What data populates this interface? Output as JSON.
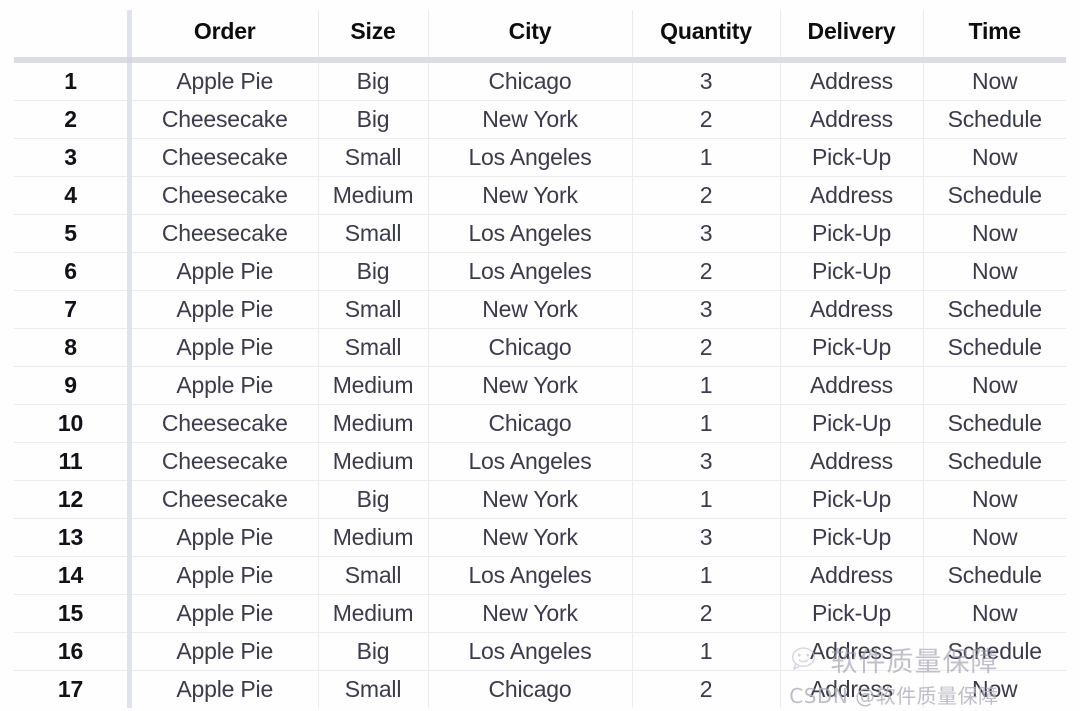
{
  "table": {
    "index_header": "",
    "columns": [
      "Order",
      "Size",
      "City",
      "Quantity",
      "Delivery",
      "Time"
    ],
    "rows": [
      {
        "index": "1",
        "Order": "Apple Pie",
        "Size": "Big",
        "City": "Chicago",
        "Quantity": "3",
        "Delivery": "Address",
        "Time": "Now"
      },
      {
        "index": "2",
        "Order": "Cheesecake",
        "Size": "Big",
        "City": "New York",
        "Quantity": "2",
        "Delivery": "Address",
        "Time": "Schedule"
      },
      {
        "index": "3",
        "Order": "Cheesecake",
        "Size": "Small",
        "City": "Los Angeles",
        "Quantity": "1",
        "Delivery": "Pick-Up",
        "Time": "Now"
      },
      {
        "index": "4",
        "Order": "Cheesecake",
        "Size": "Medium",
        "City": "New York",
        "Quantity": "2",
        "Delivery": "Address",
        "Time": "Schedule"
      },
      {
        "index": "5",
        "Order": "Cheesecake",
        "Size": "Small",
        "City": "Los Angeles",
        "Quantity": "3",
        "Delivery": "Pick-Up",
        "Time": "Now"
      },
      {
        "index": "6",
        "Order": "Apple Pie",
        "Size": "Big",
        "City": "Los Angeles",
        "Quantity": "2",
        "Delivery": "Pick-Up",
        "Time": "Now"
      },
      {
        "index": "7",
        "Order": "Apple Pie",
        "Size": "Small",
        "City": "New York",
        "Quantity": "3",
        "Delivery": "Address",
        "Time": "Schedule"
      },
      {
        "index": "8",
        "Order": "Apple Pie",
        "Size": "Small",
        "City": "Chicago",
        "Quantity": "2",
        "Delivery": "Pick-Up",
        "Time": "Schedule"
      },
      {
        "index": "9",
        "Order": "Apple Pie",
        "Size": "Medium",
        "City": "New York",
        "Quantity": "1",
        "Delivery": "Address",
        "Time": "Now"
      },
      {
        "index": "10",
        "Order": "Cheesecake",
        "Size": "Medium",
        "City": "Chicago",
        "Quantity": "1",
        "Delivery": "Pick-Up",
        "Time": "Schedule"
      },
      {
        "index": "11",
        "Order": "Cheesecake",
        "Size": "Medium",
        "City": "Los Angeles",
        "Quantity": "3",
        "Delivery": "Address",
        "Time": "Schedule"
      },
      {
        "index": "12",
        "Order": "Cheesecake",
        "Size": "Big",
        "City": "New York",
        "Quantity": "1",
        "Delivery": "Pick-Up",
        "Time": "Now"
      },
      {
        "index": "13",
        "Order": "Apple Pie",
        "Size": "Medium",
        "City": "New York",
        "Quantity": "3",
        "Delivery": "Pick-Up",
        "Time": "Now"
      },
      {
        "index": "14",
        "Order": "Apple Pie",
        "Size": "Small",
        "City": "Los Angeles",
        "Quantity": "1",
        "Delivery": "Address",
        "Time": "Schedule"
      },
      {
        "index": "15",
        "Order": "Apple Pie",
        "Size": "Medium",
        "City": "New York",
        "Quantity": "2",
        "Delivery": "Pick-Up",
        "Time": "Now"
      },
      {
        "index": "16",
        "Order": "Apple Pie",
        "Size": "Big",
        "City": "Los Angeles",
        "Quantity": "1",
        "Delivery": "Address",
        "Time": "Schedule"
      },
      {
        "index": "17",
        "Order": "Apple Pie",
        "Size": "Small",
        "City": "Chicago",
        "Quantity": "2",
        "Delivery": "Address",
        "Time": "Now"
      }
    ]
  },
  "watermark": {
    "icon": "wechat-icon",
    "title": "软件质量保障",
    "credit": "CSDN @软件质量保障"
  },
  "colors": {
    "header_text": "#0d0d0d",
    "body_text": "#3b3b4a",
    "index_text": "#111118",
    "index_separator": "#e2e2ec",
    "header_rule": "#dcdce4",
    "row_separator": "#ececec",
    "background": "#fefefe",
    "watermark_text": "#b3b3bf"
  }
}
